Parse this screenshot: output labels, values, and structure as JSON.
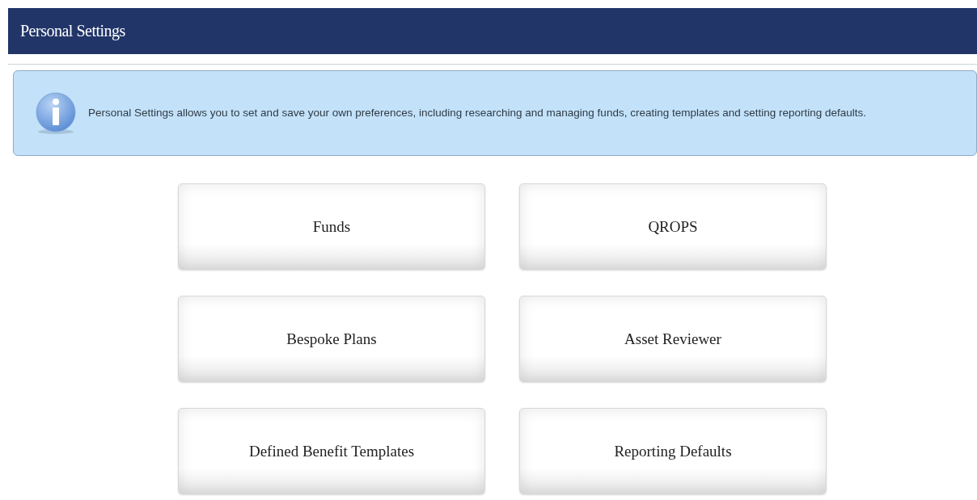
{
  "header": {
    "title": "Personal Settings"
  },
  "info": {
    "text": "Personal Settings allows you to set and save your own preferences, including researching and managing funds, creating templates and setting reporting defaults."
  },
  "tiles": [
    {
      "label": "Funds"
    },
    {
      "label": "QROPS"
    },
    {
      "label": "Bespoke Plans"
    },
    {
      "label": "Asset Reviewer"
    },
    {
      "label": "Defined Benefit Templates"
    },
    {
      "label": "Reporting Defaults"
    }
  ]
}
